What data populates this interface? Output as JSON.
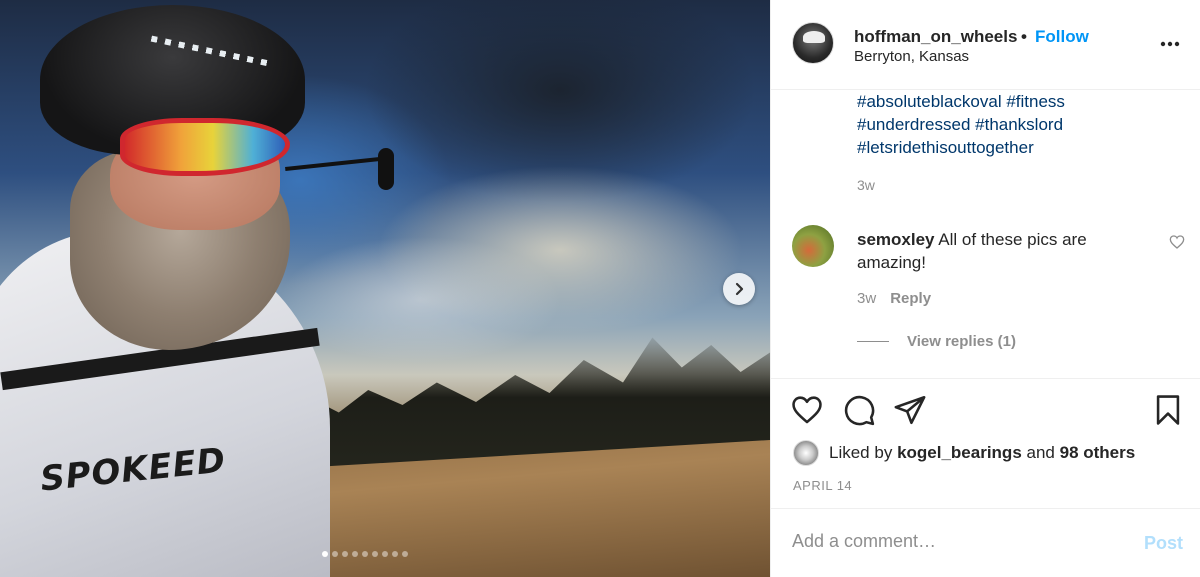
{
  "post": {
    "carousel": {
      "next_icon": "chevron-right-icon",
      "slide_count": 9,
      "active_index": 0,
      "jersey_text": "SPOKEED"
    },
    "header": {
      "username": "hoffman_on_wheels",
      "separator": "•",
      "follow_label": "Follow",
      "location": "Berryton, Kansas",
      "more_icon": "more-horizontal-icon"
    },
    "caption": {
      "hashtags": [
        "#absoluteblackoval #fitness",
        "#underdressed #thankslord",
        "#letsridethisouttogether"
      ],
      "time": "3w"
    },
    "comments": [
      {
        "username": "semoxley",
        "text": "All of these pics are amazing!",
        "time": "3w",
        "reply_label": "Reply",
        "view_replies_label": "View replies (1)"
      }
    ],
    "actions": {
      "like_icon": "heart-icon",
      "comment_icon": "comment-icon",
      "share_icon": "paper-plane-icon",
      "save_icon": "bookmark-icon"
    },
    "likes": {
      "prefix": "Liked by",
      "user": "kogel_bearings",
      "conjunction": "and",
      "others": "98 others"
    },
    "date": "APRIL 14",
    "add_comment": {
      "placeholder": "Add a comment…",
      "post_label": "Post"
    }
  },
  "colors": {
    "link_blue": "#0095f6",
    "hashtag": "#00376b",
    "muted": "#8e8e8e",
    "post_disabled": "#b2dffc"
  }
}
